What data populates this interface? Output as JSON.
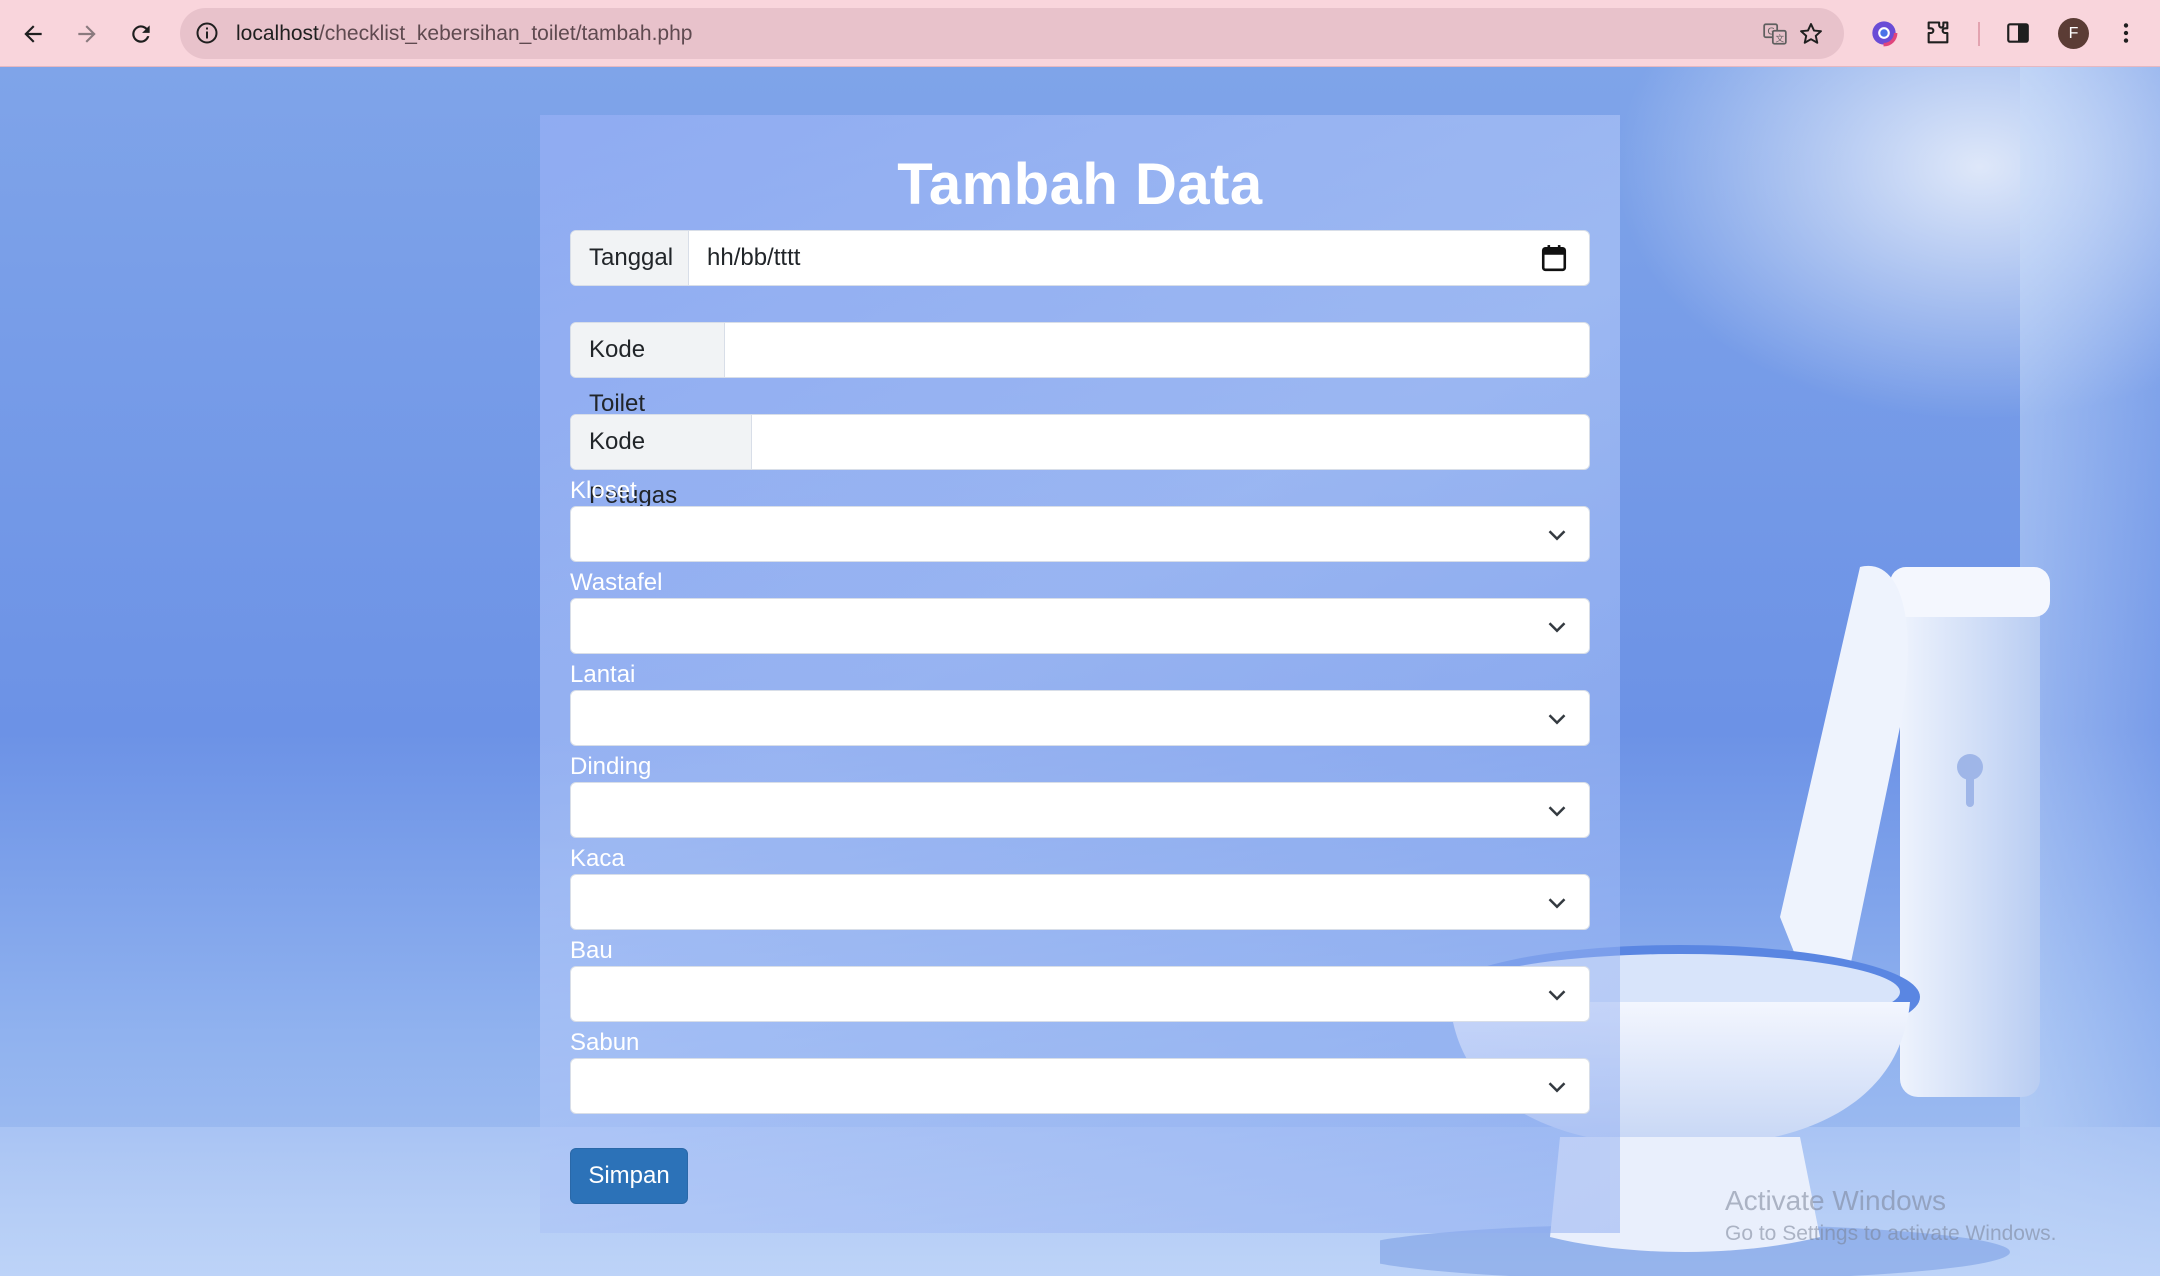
{
  "browser": {
    "url_host": "localhost",
    "url_path": "/checklist_kebersihan_toilet/tambah.php",
    "profile_initial": "F"
  },
  "form": {
    "title": "Tambah Data",
    "tanggal_label": "Tanggal",
    "tanggal_value": "hh/bb/tttt",
    "kode_toilet_label": "Kode Toilet",
    "kode_toilet_value": "",
    "kode_petugas_label": "Kode Petugas",
    "kode_petugas_value": "",
    "selects": [
      {
        "label": "Kloset",
        "value": ""
      },
      {
        "label": "Wastafel",
        "value": ""
      },
      {
        "label": "Lantai",
        "value": ""
      },
      {
        "label": "Dinding",
        "value": ""
      },
      {
        "label": "Kaca",
        "value": ""
      },
      {
        "label": "Bau",
        "value": ""
      },
      {
        "label": "Sabun",
        "value": ""
      }
    ],
    "submit_label": "Simpan"
  },
  "watermark": {
    "line1": "Activate Windows",
    "line2": "Go to Settings to activate Windows."
  },
  "colors": {
    "chrome": "#f9d5dc",
    "button": "#2c72b8",
    "title": "#ffffff"
  },
  "icons": [
    "back-arrow-icon",
    "forward-arrow-icon",
    "reload-icon",
    "site-info-icon",
    "translate-icon",
    "bookmark-star-icon",
    "color-extension-icon",
    "extensions-puzzle-icon",
    "side-panel-icon",
    "more-menu-icon",
    "calendar-icon",
    "chevron-down-icon"
  ]
}
